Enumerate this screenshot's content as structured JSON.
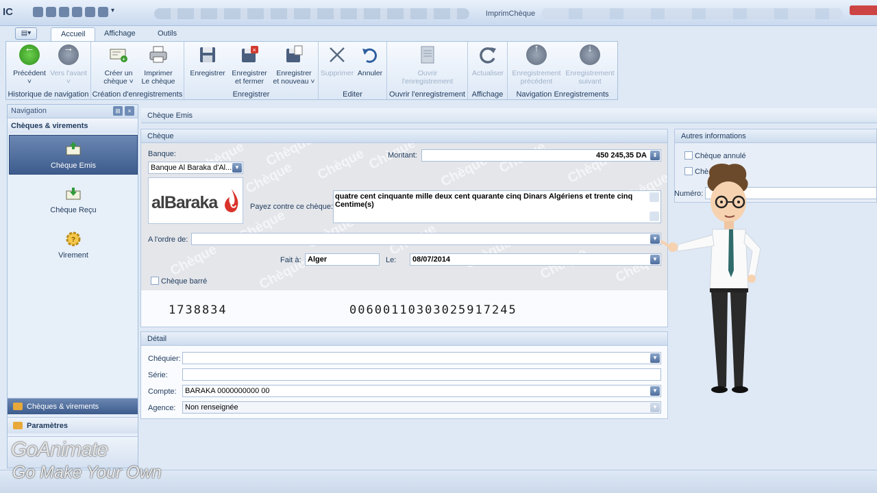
{
  "window": {
    "title": "ImprimChèque",
    "app_logo": "IC"
  },
  "ribbon": {
    "tabs": [
      "Accueil",
      "Affichage",
      "Outils"
    ],
    "active_tab": "Accueil",
    "groups": {
      "nav": {
        "label": "Historique de navigation",
        "prev": "Précédent",
        "next": "Vers l'avant"
      },
      "create": {
        "label": "Création d'enregistrements",
        "create_line1": "Créer un",
        "create_line2": "chèque ˅",
        "print_line1": "Imprimer",
        "print_line2": "Le chèque"
      },
      "save": {
        "label": "Enregistrer",
        "save": "Enregistrer",
        "save_close_1": "Enregistrer",
        "save_close_2": "et fermer",
        "save_new_1": "Enregistrer",
        "save_new_2": "et nouveau ˅"
      },
      "edit": {
        "label": "Editer",
        "delete": "Supprimer",
        "undo": "Annuler"
      },
      "open": {
        "label": "Ouvrir l'enregistrement",
        "open_1": "Ouvrir",
        "open_2": "l'enregistrement"
      },
      "view": {
        "label": "Affichage",
        "refresh": "Actualiser"
      },
      "records": {
        "label": "Navigation Enregistrements",
        "prev_1": "Enregistrement",
        "prev_2": "précédent",
        "next_1": "Enregistrement",
        "next_2": "suivant"
      }
    }
  },
  "navigation": {
    "header": "Navigation",
    "section": "Chèques & virements",
    "items": [
      {
        "label": "Chèque Emis",
        "active": true
      },
      {
        "label": "Chèque Reçu",
        "active": false
      },
      {
        "label": "Virement",
        "active": false
      }
    ],
    "bottom": [
      "Chèques & virements",
      "Paramètres"
    ]
  },
  "document": {
    "title": "Chèque Emis",
    "cheque_panel": {
      "title": "Chèque",
      "watermark": "Chèque",
      "banque_label": "Banque:",
      "banque_value": "Banque Al Baraka d'Al...",
      "logo_text": "alBaraka",
      "montant_label": "Montant:",
      "montant_value": "450 245,35 DA",
      "payez_label": "Payez contre ce chèque:",
      "payez_value": "quatre cent cinquante  mille deux cent quarante cinq Dinars Algériens et trente cinq Centime(s)",
      "ordre_label": "A l'ordre de:",
      "ordre_value": "",
      "fait_label": "Fait à:",
      "fait_value": "Alger",
      "le_label": "Le:",
      "le_value": "08/07/2014",
      "barre_label": "Chèque barré",
      "cheque_number": "1738834",
      "account_number": "00600110303025917245"
    },
    "detail_panel": {
      "title": "Détail",
      "chequier_label": "Chéquier:",
      "chequier_value": "",
      "serie_label": "Série:",
      "serie_value": "",
      "compte_label": "Compte:",
      "compte_value": "BARAKA 0000000000 00",
      "agence_label": "Agence:",
      "agence_value": "Non renseignée"
    },
    "other_panel": {
      "title": "Autres informations",
      "annule_label": "Chèque annulé",
      "second_label": "Chè",
      "numero_label": "Numéro:"
    }
  },
  "watermark": {
    "line1": "GoAnimate",
    "line2": "Go Make Your Own"
  },
  "colors": {
    "accent": "#3d5c8c",
    "panel_border": "#b3c7e2",
    "background": "#dfe9f5"
  }
}
